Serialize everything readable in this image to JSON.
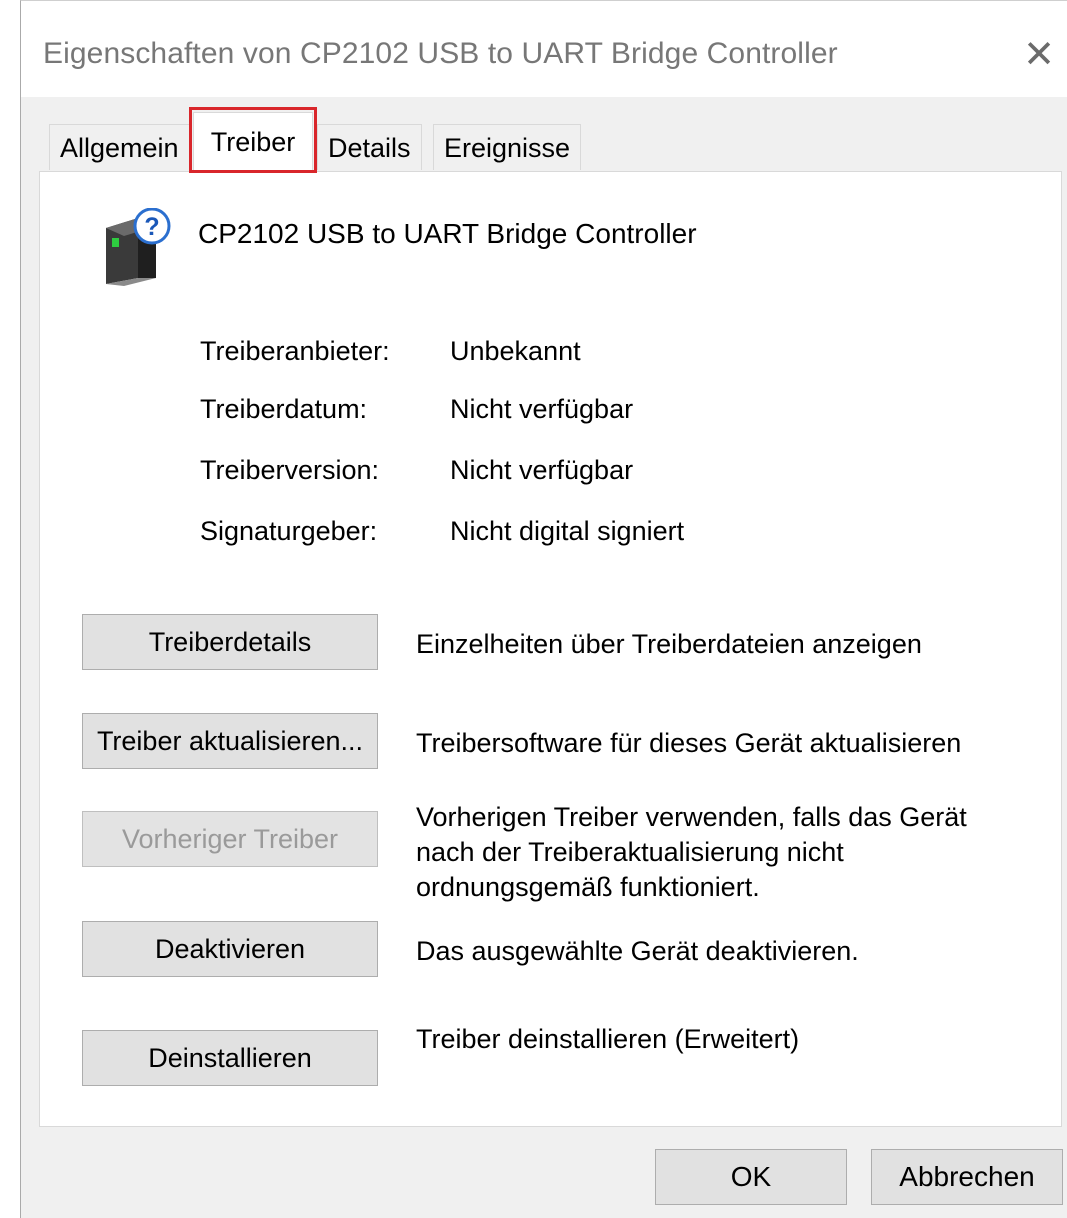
{
  "window": {
    "title": "Eigenschaften von CP2102 USB to UART Bridge Controller",
    "close_glyph": "✕"
  },
  "tabs": [
    {
      "label": "Allgemein",
      "active": false
    },
    {
      "label": "Treiber",
      "active": true
    },
    {
      "label": "Details",
      "active": false
    },
    {
      "label": "Ereignisse",
      "active": false
    }
  ],
  "device": {
    "name": "CP2102 USB to UART Bridge Controller",
    "icon": "unknown-device-icon"
  },
  "driver_info": [
    {
      "label": "Treiberanbieter:",
      "value": "Unbekannt"
    },
    {
      "label": "Treiberdatum:",
      "value": "Nicht verfügbar"
    },
    {
      "label": "Treiberversion:",
      "value": "Nicht verfügbar"
    },
    {
      "label": "Signaturgeber:",
      "value": "Nicht digital signiert"
    }
  ],
  "actions": [
    {
      "label": "Treiberdetails",
      "description": "Einzelheiten über Treiberdateien anzeigen",
      "enabled": true
    },
    {
      "label": "Treiber aktualisieren...",
      "description": "Treibersoftware für dieses Gerät aktualisieren",
      "enabled": true
    },
    {
      "label": "Vorheriger Treiber",
      "description_lines": [
        "Vorherigen Treiber verwenden, falls das Gerät",
        "nach der Treiberaktualisierung nicht",
        "ordnungsgemäß funktioniert."
      ],
      "enabled": false
    },
    {
      "label": "Deaktivieren",
      "description": "Das ausgewählte Gerät deaktivieren.",
      "enabled": true
    },
    {
      "label": "Deinstallieren",
      "description": "Treiber deinstallieren (Erweitert)",
      "enabled": true
    }
  ],
  "footer": {
    "ok_label": "OK",
    "cancel_label": "Abbrechen"
  },
  "colors": {
    "highlight_box": "#d9262b",
    "disabled_text": "#9a9a9a",
    "title_text": "#777777"
  }
}
